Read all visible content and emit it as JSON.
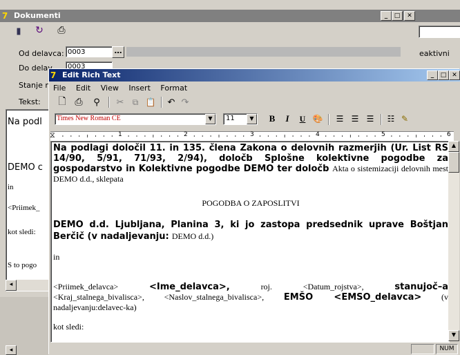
{
  "back_window": {
    "title": "Dokumenti",
    "labels": {
      "od_delavca": "Od delavca:",
      "do_delavca": "Do delav",
      "stanje": "Stanje n",
      "tekst": "Tekst:"
    },
    "od_value": "0003",
    "do_value": "0003",
    "status_right": "eaktivni",
    "preview_lines": [
      "Na podl",
      "DEMO c",
      "in",
      "<Priimek_",
      "kot sledi:",
      "S to pogo"
    ]
  },
  "editor": {
    "title": "Edit Rich Text",
    "menu": [
      "File",
      "Edit",
      "View",
      "Insert",
      "Format"
    ],
    "font_name": "Times New Roman CE",
    "font_size": "11",
    "ruler_numbers": [
      "1",
      "2",
      "3",
      "4",
      "5",
      "6"
    ],
    "status": "NUM",
    "doc": {
      "p1_bold": "Na podlagi določil 11. in 135. člena Zakona o delovnih razmerjih (Ur. List RS 14/90, 5/91, 71/93, 2/94), določb Splošne kolektivne pogodbe za gospodarstvo in Kolektivne pogodbe DEMO ter določb",
      "p1_serif": "Akta o sistemizaciji delovnih mest DEMO d.d., sklepata",
      "heading": "POGODBA O ZAPOSLITVI",
      "p2_bold": "DEMO d.d. Ljubljana, Planina 3, ki jo zastopa predsednik uprave Boštjan Berčič (v nadaljevanju:",
      "p2_serif": "DEMO d.d.)",
      "in": "in",
      "p3_a": "<Priimek_delavca>",
      "p3_b": "<Ime_delavca>,",
      "p3_c": "roj.",
      "p3_d": "<Datum_rojstva>,",
      "p3_e": "stanujoč–a",
      "p3_f": "<Kraj_stalnega_bivalisca>, <Naslov_stalnega_bivalisca>,",
      "p3_g": "EMŠO <EMSO_delavca>",
      "p3_h": "(v nadaljevanju:delavec-ka)",
      "kot": "kot sledi:"
    }
  }
}
